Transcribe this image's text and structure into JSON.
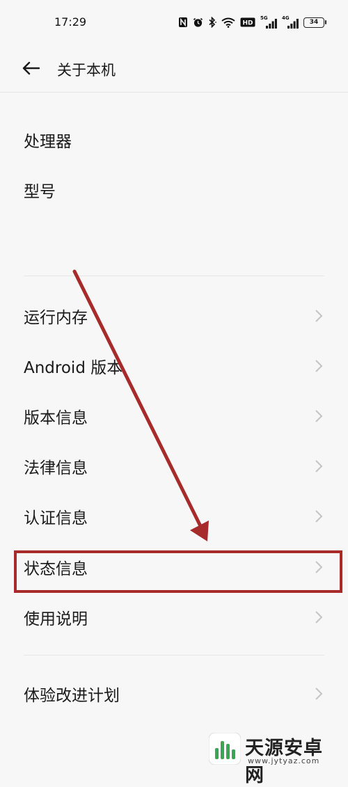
{
  "status_bar": {
    "time": "17:29",
    "network_5g": "5G",
    "network_4g": "4G",
    "hd_badge": "HD",
    "battery_level": "34"
  },
  "header": {
    "title": "关于本机"
  },
  "info_section": {
    "items": [
      {
        "label": "处理器"
      },
      {
        "label": "型号"
      }
    ]
  },
  "menu": {
    "items": [
      {
        "label": "运行内存"
      },
      {
        "label": "Android 版本"
      },
      {
        "label": "版本信息"
      },
      {
        "label": "法律信息"
      },
      {
        "label": "认证信息"
      },
      {
        "label": "状态信息"
      },
      {
        "label": "使用说明"
      },
      {
        "label": "体验改进计划"
      }
    ]
  },
  "annotation": {
    "highlight_color": "#a72b2b",
    "highlighted_item": "状态信息"
  },
  "watermark": {
    "name": "天源安卓网",
    "url": "www.jytyaz.com"
  }
}
